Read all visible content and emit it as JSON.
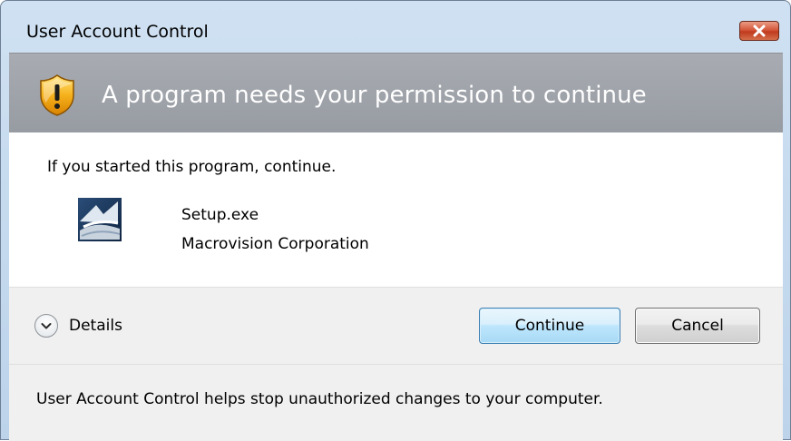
{
  "window": {
    "title": "User Account Control",
    "close_icon": "close-icon"
  },
  "banner": {
    "icon": "shield-warning-icon",
    "heading": "A program needs your permission to continue"
  },
  "body": {
    "intro": "If you started this program, continue.",
    "program": {
      "icon": "program-setup-icon",
      "name": "Setup.exe",
      "publisher": "Macrovision Corporation"
    }
  },
  "actions": {
    "details_label": "Details",
    "details_icon": "chevron-down-icon",
    "continue_label": "Continue",
    "cancel_label": "Cancel"
  },
  "footer": {
    "text": "User Account Control helps stop unauthorized changes to your computer."
  },
  "colors": {
    "banner": "#9ca0a6",
    "banner_text": "#ffffff",
    "close_button": "#c8452a",
    "default_button_border": "#3c7fb1",
    "panel": "#f0f0f0"
  }
}
